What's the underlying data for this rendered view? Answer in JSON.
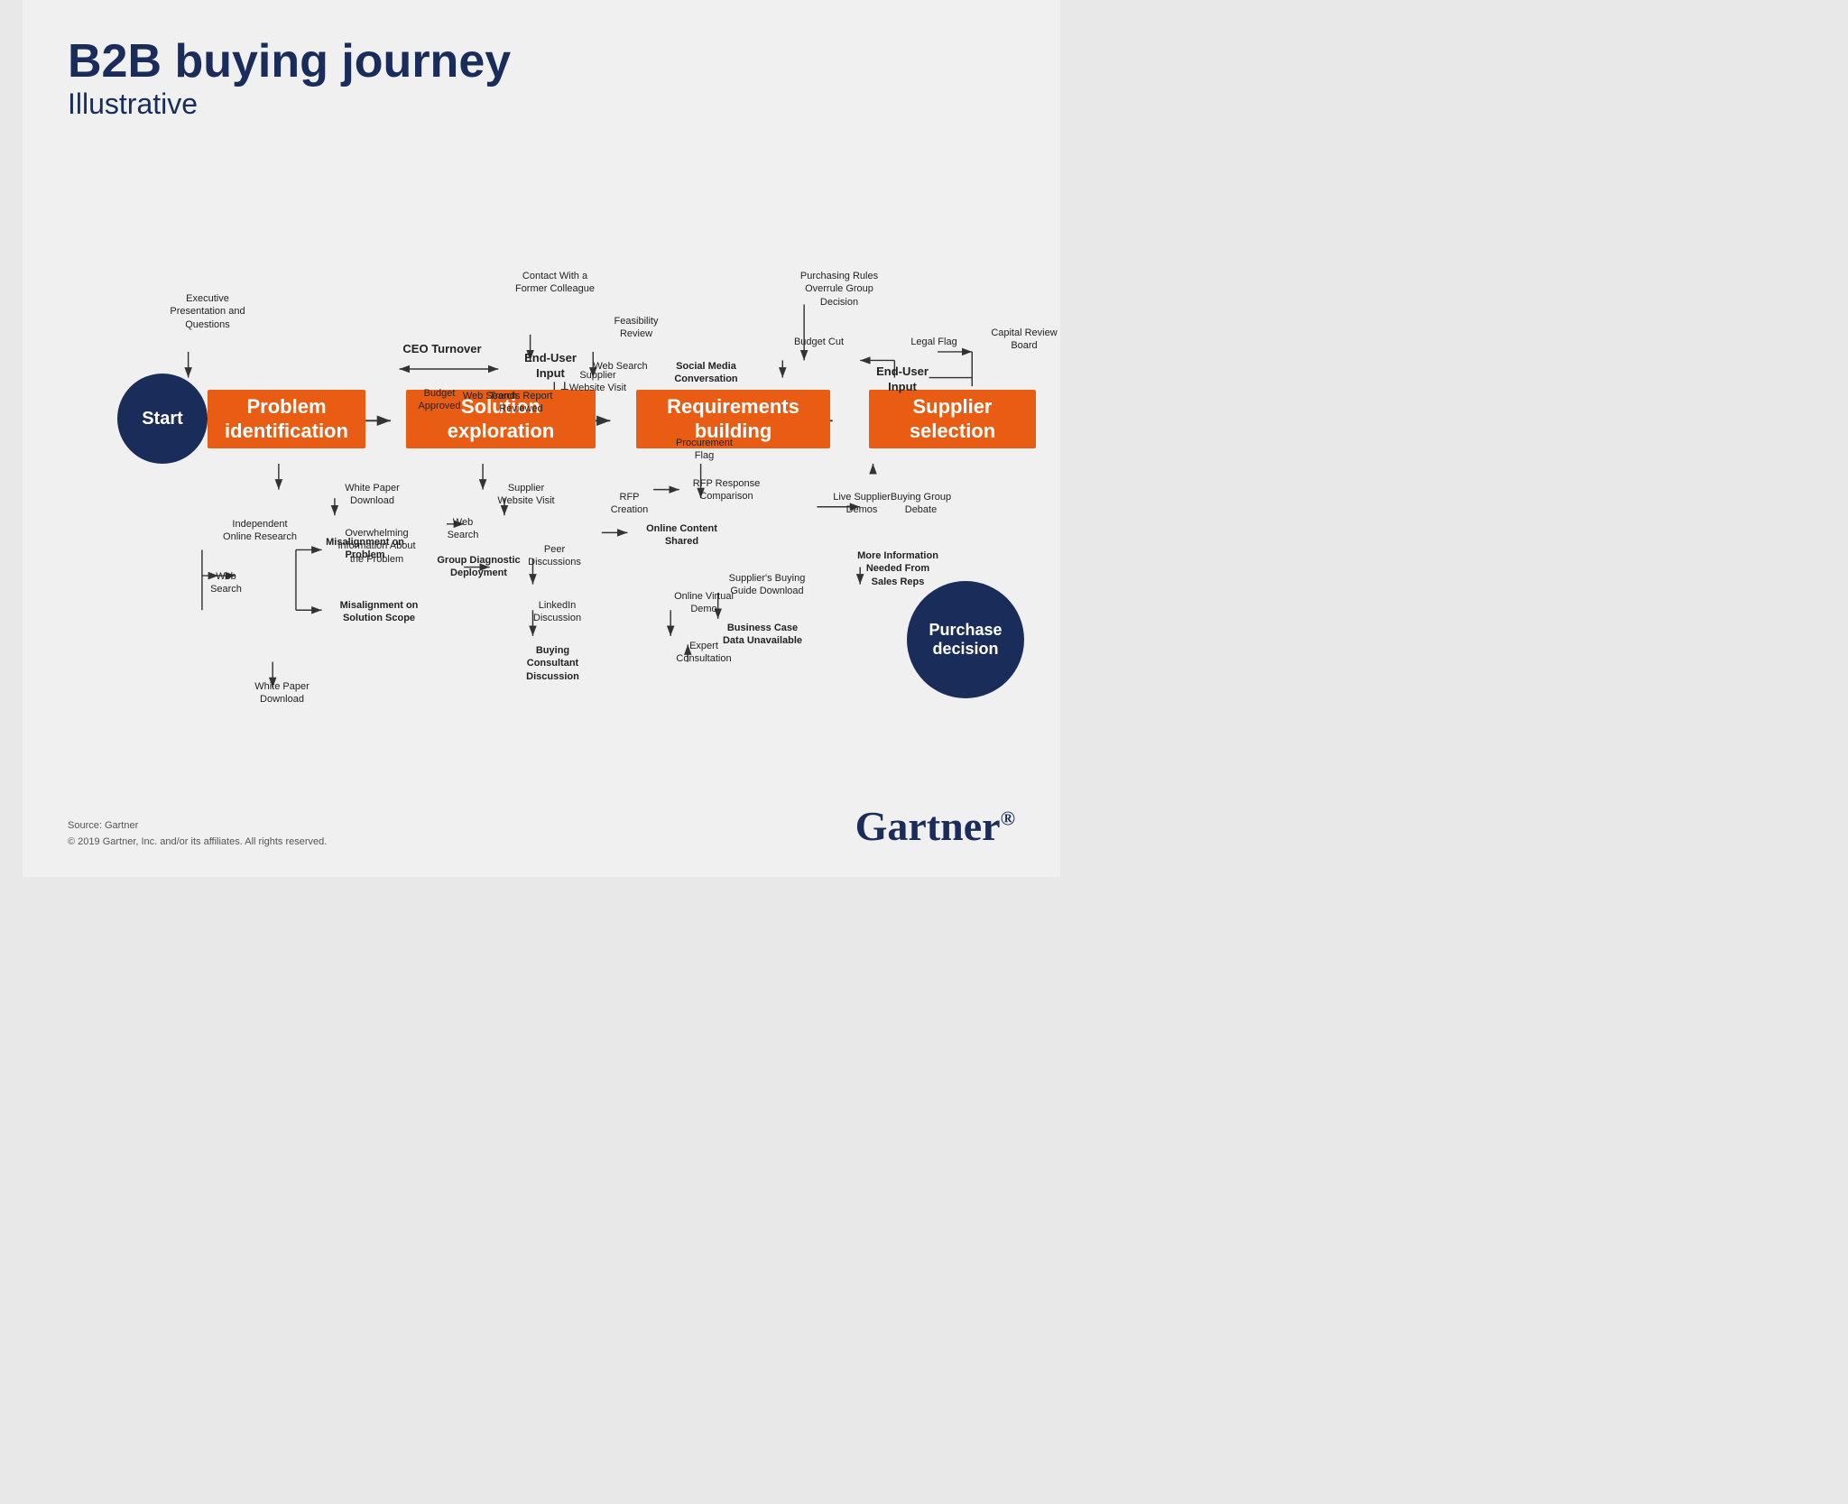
{
  "title": {
    "main": "B2B buying journey",
    "sub": "Illustrative"
  },
  "stages": [
    {
      "id": "problem",
      "label": "Problem identification"
    },
    {
      "id": "solution",
      "label": "Solution exploration"
    },
    {
      "id": "requirements",
      "label": "Requirements building"
    },
    {
      "id": "supplier",
      "label": "Supplier selection"
    }
  ],
  "start_label": "Start",
  "purchase_label": "Purchase decision",
  "annotations": {
    "above": [
      "Executive Presentation and Questions",
      "CEO Turnover",
      "Budget Approved",
      "Web Search",
      "Trends Report Reviewed",
      "Contact With a Former Colleague",
      "End-User Input",
      "Feasibility Review",
      "Web Search",
      "Supplier Website Visit",
      "Procurement Flag",
      "Social Media Conversation",
      "Purchasing Rules Overrule Group Decision",
      "Budget Cut",
      "Legal Flag",
      "End-User Input",
      "Capital Review Board"
    ],
    "below": [
      "Independent Online Research",
      "Web Search",
      "Misalignment on Problem",
      "White Paper Download",
      "Overwhelming Information About the Problem",
      "Misalignment on Solution Scope",
      "White Paper Download",
      "Web Search",
      "Group Diagnostic Deployment",
      "Supplier Website Visit",
      "Peer Discussions",
      "LinkedIn Discussion",
      "Buying Consultant Discussion",
      "RFP Creation",
      "Online Content Shared",
      "RFP Response Comparison",
      "Online Virtual Demo",
      "Expert Consultation",
      "Supplier's Buying Guide Download",
      "Business Case Data Unavailable",
      "Live Supplier Demos",
      "Buying Group Debate",
      "More Information Needed From Sales Reps"
    ]
  },
  "footer": {
    "source": "Source: Gartner",
    "copyright": "© 2019 Gartner, Inc. and/or its affiliates. All rights reserved.",
    "logo": "Gartner"
  }
}
